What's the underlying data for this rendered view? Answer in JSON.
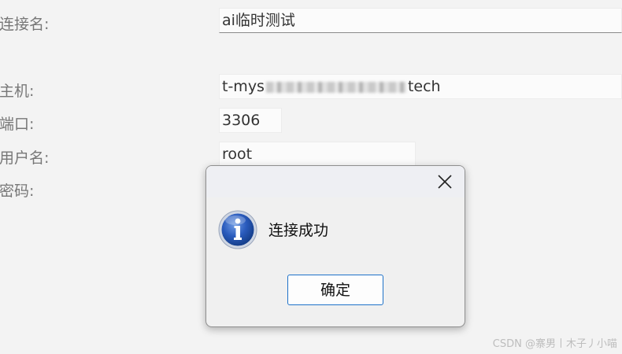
{
  "form": {
    "connection_name_label": "连接名:",
    "connection_name_value": "ai临时测试",
    "host_label": "主机:",
    "host_value_prefix": "t-mys",
    "host_value_suffix": "tech",
    "port_label": "端口:",
    "port_value": "3306",
    "username_label": "用户名:",
    "username_value": "root",
    "password_label": "密码:"
  },
  "dialog": {
    "icon": "info-icon",
    "message": "连接成功",
    "ok_label": "确定",
    "close_icon": "close-icon"
  },
  "watermark": "CSDN @寨男丨木子丿小喵",
  "colors": {
    "background": "#f3f3f3",
    "dialog_background": "#f0f0f0",
    "button_border": "#1e72c9",
    "info_icon_blue": "#1f4fa8"
  }
}
